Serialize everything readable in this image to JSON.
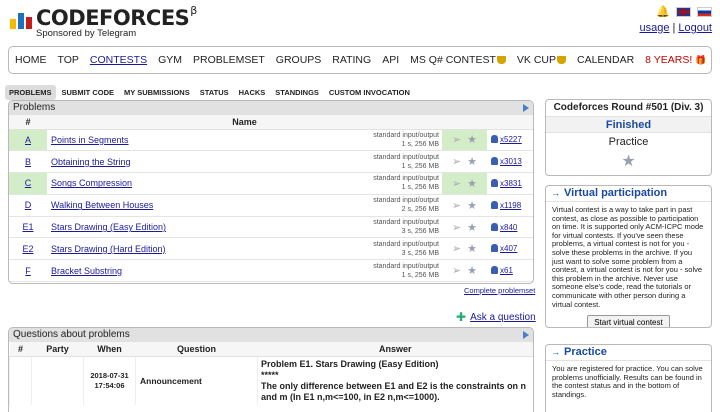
{
  "header": {
    "logo_text": "CODEFORCES",
    "logo_beta": "β",
    "tagline": "Sponsored by Telegram",
    "user_links": [
      "usage",
      "Logout"
    ],
    "colors": {
      "logo_yellow": "#f5b900",
      "logo_blue": "#1f72b8",
      "logo_red": "#c41e1e"
    }
  },
  "menu": {
    "items": [
      {
        "label": "HOME"
      },
      {
        "label": "TOP"
      },
      {
        "label": "CONTESTS"
      },
      {
        "label": "GYM"
      },
      {
        "label": "PROBLEMSET"
      },
      {
        "label": "GROUPS"
      },
      {
        "label": "RATING"
      },
      {
        "label": "API"
      },
      {
        "label": "MS Q# CONTEST"
      },
      {
        "label": "VK CUP"
      },
      {
        "label": "CALENDAR"
      },
      {
        "label": "8 YEARS!"
      }
    ],
    "active": "CONTESTS"
  },
  "submenu": {
    "items": [
      "PROBLEMS",
      "SUBMIT CODE",
      "MY SUBMISSIONS",
      "STATUS",
      "HACKS",
      "STANDINGS",
      "CUSTOM INVOCATION"
    ],
    "active": "PROBLEMS"
  },
  "problems": {
    "title": "Problems",
    "headers": {
      "id": "#",
      "name": "Name"
    },
    "rows": [
      {
        "id": "A",
        "name": "Points in Segments",
        "io": "standard input/output",
        "limits": "1 s, 256 MB",
        "solved": "x5227",
        "accepted": true
      },
      {
        "id": "B",
        "name": "Obtaining the String",
        "io": "standard input/output",
        "limits": "1 s, 256 MB",
        "solved": "x3013",
        "accepted": false
      },
      {
        "id": "C",
        "name": "Songs Compression",
        "io": "standard input/output",
        "limits": "1 s, 256 MB",
        "solved": "x3831",
        "accepted": true
      },
      {
        "id": "D",
        "name": "Walking Between Houses",
        "io": "standard input/output",
        "limits": "2 s, 256 MB",
        "solved": "x1198",
        "accepted": false
      },
      {
        "id": "E1",
        "name": "Stars Drawing (Easy Edition)",
        "io": "standard input/output",
        "limits": "3 s, 256 MB",
        "solved": "x840",
        "accepted": false
      },
      {
        "id": "E2",
        "name": "Stars Drawing (Hard Edition)",
        "io": "standard input/output",
        "limits": "3 s, 256 MB",
        "solved": "x407",
        "accepted": false
      },
      {
        "id": "F",
        "name": "Bracket Substring",
        "io": "standard input/output",
        "limits": "1 s, 256 MB",
        "solved": "x61",
        "accepted": false
      }
    ],
    "complete_link": "Complete problemset",
    "ask_link": "Ask a question"
  },
  "questions": {
    "title": "Questions about problems",
    "headers": {
      "id": "#",
      "party": "Party",
      "when": "When",
      "question": "Question",
      "answer": "Answer"
    },
    "row": {
      "when_date": "2018-07-31",
      "when_time": "17:54:06",
      "question": "Announcement",
      "answer_line1": "Problem E1. Stars Drawing (Easy Edition)",
      "answer_line2": "*****",
      "answer_line3": "The only difference between E1 and E2 is the constraints on n and m (In E1 n,m<=100, in E2 n,m<=1000)."
    }
  },
  "sidebar": {
    "round": {
      "title": "Codeforces Round #501 (Div. 3)",
      "status": "Finished",
      "practice": "Practice"
    },
    "virtual": {
      "title": "Virtual participation",
      "text": "Virtual contest is a way to take part in past contest, as close as possible to participation on time. It is supported only ACM-ICPC mode for virtual contests. If you've seen these problems, a virtual contest is not for you - solve these problems in the archive. If you just want to solve some problem from a contest, a virtual contest is not for you - solve this problem in the archive. Never use someone else's code, read the tutorials or communicate with other person during a virtual contest.",
      "button": "Start virtual contest"
    },
    "practice": {
      "title": "Practice",
      "text": "You are registered for practice. You can solve problems unofficially. Results can be found in the contest status and in the bottom of standings."
    }
  }
}
